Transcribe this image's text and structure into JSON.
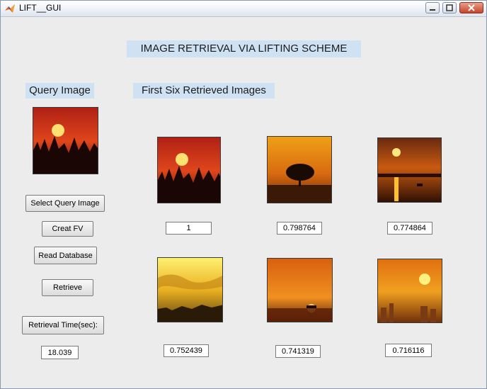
{
  "window": {
    "title": "LIFT__GUI"
  },
  "header": {
    "title": "IMAGE RETRIEVAL VIA LIFTING SCHEME"
  },
  "query": {
    "label": "Query Image"
  },
  "results": {
    "label": "First Six Retrieved Images",
    "scores": [
      "1",
      "0.798764",
      "0.774864",
      "0.752439",
      "0.741319",
      "0.716116"
    ]
  },
  "buttons": {
    "select_query": "Select Query Image",
    "creat_fv": "Creat FV",
    "read_db": "Read Database",
    "retrieve": "Retrieve",
    "retrieval_time": "Retrieval Time(sec):"
  },
  "retrieval_time": {
    "value": "18.039"
  },
  "icons": {
    "app": "matlab-icon",
    "minimize": "minimize-icon",
    "maximize": "maximize-icon",
    "close": "close-icon"
  },
  "colors": {
    "label_bg": "#cfe2f3",
    "panel_bg": "#ececec"
  }
}
